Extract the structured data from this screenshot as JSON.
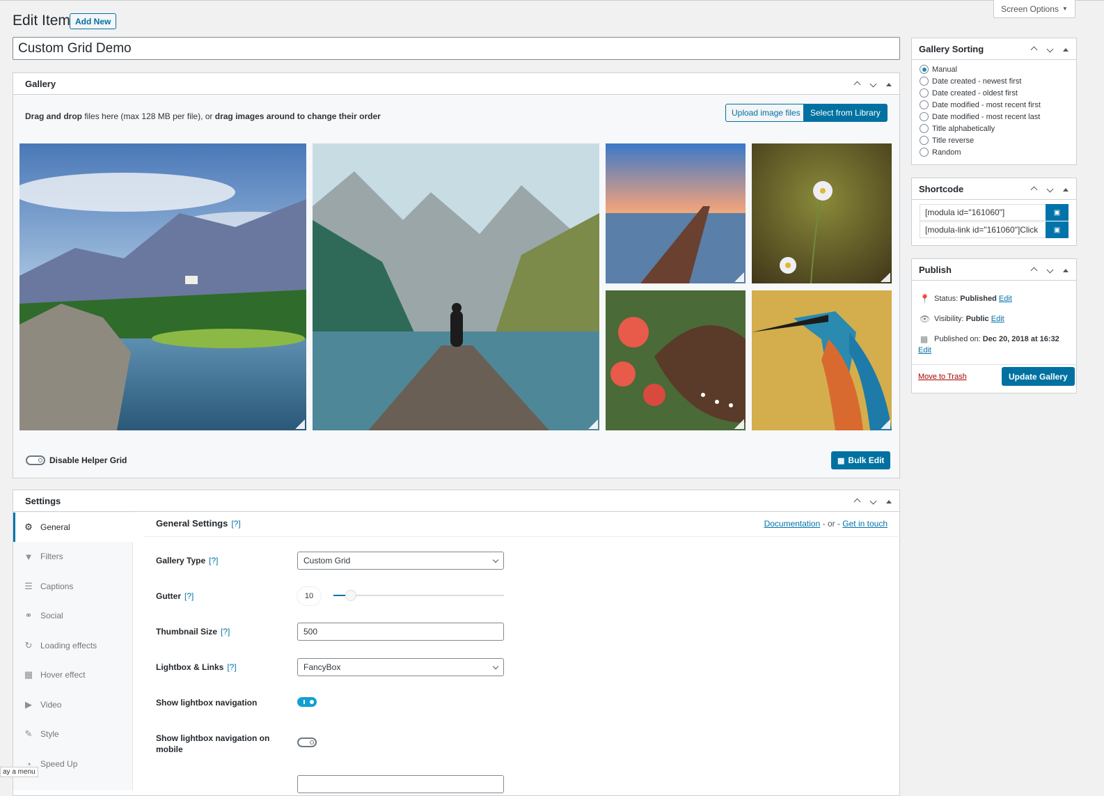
{
  "header": {
    "title": "Edit Item",
    "add_new_label": "Add New",
    "screen_options_label": "Screen Options"
  },
  "post_title_value": "Custom Grid Demo",
  "gallery_box": {
    "title": "Gallery",
    "upload_text_bold1": "Drag and drop",
    "upload_text_mid": " files here (max 128 MB per file), or ",
    "upload_text_bold2": "drag images around to change their order",
    "upload_button": "Upload image files",
    "library_button": "Select from Library",
    "images": [
      "mountain-lake-landscape",
      "dock-lake-mountains-person",
      "sunset-pier",
      "daisy-flowers",
      "butterfly-on-red-flower",
      "kingfisher-bird"
    ],
    "helper_grid_label": "Disable Helper Grid",
    "bulk_edit_label": "Bulk Edit"
  },
  "settings_box": {
    "title": "Settings",
    "nav": [
      {
        "label": "General",
        "icon": "gear-icon",
        "active": true
      },
      {
        "label": "Filters",
        "icon": "filter-icon"
      },
      {
        "label": "Captions",
        "icon": "captions-icon"
      },
      {
        "label": "Social",
        "icon": "link-icon"
      },
      {
        "label": "Loading effects",
        "icon": "refresh-icon"
      },
      {
        "label": "Hover effect",
        "icon": "grid-icon"
      },
      {
        "label": "Video",
        "icon": "video-icon"
      },
      {
        "label": "Style",
        "icon": "brush-icon"
      },
      {
        "label": "Speed Up",
        "icon": "dashboard-icon"
      }
    ],
    "general_title": "General Settings",
    "help_marker": "[?]",
    "documentation_link": "Documentation",
    "or_text": " - or - ",
    "contact_link": "Get in touch",
    "fields": {
      "gallery_type_label": "Gallery Type",
      "gallery_type_value": "Custom Grid",
      "gutter_label": "Gutter",
      "gutter_value": "10",
      "gutter_fraction": 0.1,
      "thumb_size_label": "Thumbnail Size",
      "thumb_size_value": "500",
      "lightbox_label": "Lightbox & Links",
      "lightbox_value": "FancyBox",
      "show_nav_label": "Show lightbox navigation",
      "show_nav_on": true,
      "show_nav_mobile_label": "Show lightbox navigation on mobile",
      "show_nav_mobile_on": false
    }
  },
  "sidebar": {
    "sorting": {
      "title": "Gallery Sorting",
      "options": [
        "Manual",
        "Date created - newest first",
        "Date created - oldest first",
        "Date modified - most recent first",
        "Date modified - most recent last",
        "Title alphabetically",
        "Title reverse",
        "Random"
      ],
      "selected_index": 0
    },
    "shortcode": {
      "title": "Shortcode",
      "values": [
        "[modula id=\"161060\"]",
        "[modula-link id=\"161060\"]Click"
      ]
    },
    "publish": {
      "title": "Publish",
      "status_label": "Status: ",
      "status_value": "Published",
      "visibility_label": "Visibility: ",
      "visibility_value": "Public",
      "published_label": "Published on: ",
      "published_value": "Dec 20, 2018 at 16:32",
      "edit_link": "Edit",
      "trash_label": "Move to Trash",
      "update_label": "Update Gallery"
    }
  },
  "tooltip_text": "ay a menu",
  "colors": {
    "accent": "#0071a1",
    "toggle_on": "#11a0d2",
    "trash": "#aa0000"
  }
}
